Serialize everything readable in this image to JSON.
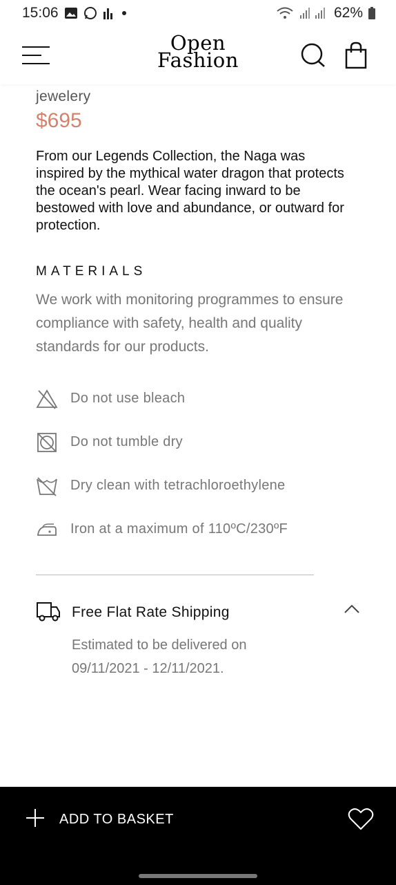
{
  "status_bar": {
    "time": "15:06",
    "battery": "62%",
    "icons": [
      "gallery-icon",
      "whatsapp-icon",
      "signal-bars-icon",
      "dot-icon",
      "wifi-icon",
      "cell-signal-icon",
      "battery-icon"
    ]
  },
  "header": {
    "brand_line1": "Open",
    "brand_line2": "Fashion",
    "icons": [
      "menu-icon",
      "search-icon",
      "shopping-bag-icon"
    ]
  },
  "product": {
    "category": "jewelery",
    "price": "$695",
    "price_color": "#d4826b",
    "description": "From our Legends Collection, the Naga was inspired by the mythical water dragon that protects the ocean's pearl. Wear facing inward to be bestowed with love and abundance, or outward for protection."
  },
  "materials": {
    "title": "MATERIALS",
    "text": "We work with monitoring programmes to ensure compliance with safety, health and quality standards for our products.",
    "care": [
      {
        "icon": "no-bleach-icon",
        "label": "Do not use bleach"
      },
      {
        "icon": "no-tumble-dry-icon",
        "label": "Do not tumble dry"
      },
      {
        "icon": "dry-clean-icon",
        "label": "Dry clean with tetrachloroethylene"
      },
      {
        "icon": "iron-icon",
        "label": "Iron at a maximum of 110ºC/230ºF"
      }
    ]
  },
  "shipping": {
    "icon": "truck-icon",
    "title": "Free Flat Rate Shipping",
    "detail_line1": "Estimated to be delivered on",
    "detail_line2": "09/11/2021 - 12/11/2021."
  },
  "bottom_bar": {
    "add_label": "ADD TO BASKET",
    "icons": [
      "plus-icon",
      "heart-icon"
    ]
  }
}
